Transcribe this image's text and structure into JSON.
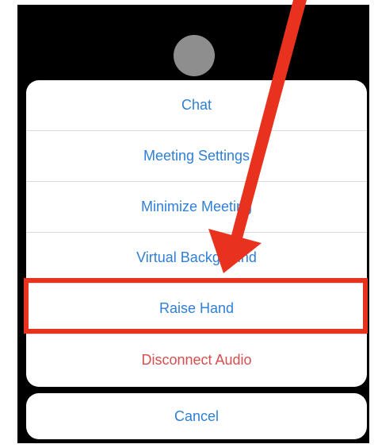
{
  "menu": {
    "items": [
      {
        "label": "Chat"
      },
      {
        "label": "Meeting Settings"
      },
      {
        "label": "Minimize Meeting"
      },
      {
        "label": "Virtual Background"
      },
      {
        "label": "Raise Hand"
      },
      {
        "label": "Disconnect Audio"
      }
    ],
    "cancel_label": "Cancel"
  },
  "colors": {
    "action_blue": "#2f7fd6",
    "destructive_red": "#d64e4e",
    "annotation_red": "#e8321e"
  }
}
